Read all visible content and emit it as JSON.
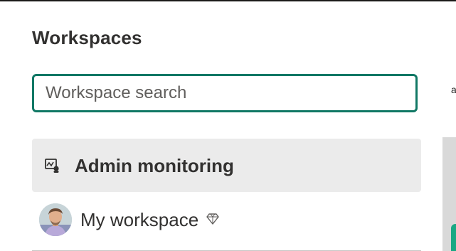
{
  "panel": {
    "title": "Workspaces"
  },
  "search": {
    "placeholder": "Workspace search",
    "value": ""
  },
  "workspaces": [
    {
      "label": "Admin monitoring",
      "icon": "monitoring-icon",
      "selected": true
    },
    {
      "label": "My workspace",
      "icon": "avatar",
      "premium_icon": "diamond-icon",
      "selected": false
    }
  ],
  "background": {
    "edge_text": "a"
  },
  "colors": {
    "search_border": "#117865",
    "selected_bg": "#ebebeb",
    "text": "#323130",
    "accent": "#1aa884"
  }
}
